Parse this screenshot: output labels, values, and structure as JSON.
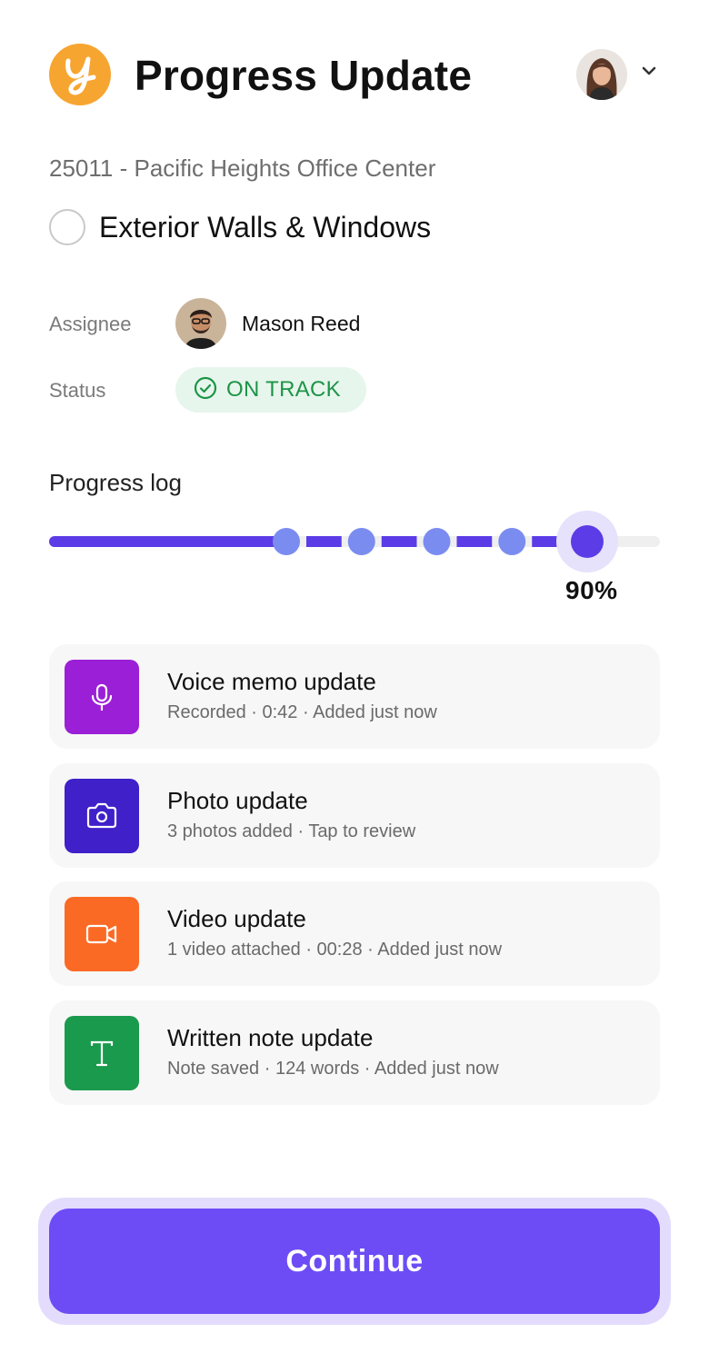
{
  "header": {
    "title": "Progress Update",
    "logo_icon": "brand-logo-y",
    "user_avatar_icon": "user-avatar",
    "menu_icon": "chevron-down-icon"
  },
  "project": {
    "label": "25011 - Pacific Heights Office Center"
  },
  "task": {
    "name": "Exterior Walls & Windows",
    "checked": false
  },
  "assignee": {
    "label": "Assignee",
    "name": "Mason Reed"
  },
  "status": {
    "label": "Status",
    "value": "ON TRACK",
    "color": "#1d9448",
    "bg": "#e7f6ec"
  },
  "progress": {
    "title": "Progress log",
    "value": 90,
    "value_label": "90%",
    "checkpoints": 4,
    "accent": "#5b3ce6",
    "checkpoint_color": "#7b8cf0"
  },
  "updates": [
    {
      "title": "Voice memo update",
      "subtitle": "Recorded · 0:42 · Added just now",
      "icon": "microphone-icon",
      "color": "#9b1fd6"
    },
    {
      "title": "Photo update",
      "subtitle": "3 photos added · Tap to review",
      "icon": "camera-icon",
      "color": "#3f20c9"
    },
    {
      "title": "Video update",
      "subtitle": "1 video attached · 00:28 · Added just now",
      "icon": "video-camera-icon",
      "color": "#fb6a24"
    },
    {
      "title": "Written note update",
      "subtitle": "Note saved · 124 words · Added just now",
      "icon": "text-note-icon",
      "color": "#1a9a4c"
    }
  ],
  "footer": {
    "continue_label": "Continue",
    "accent": "#6d4cf6"
  }
}
